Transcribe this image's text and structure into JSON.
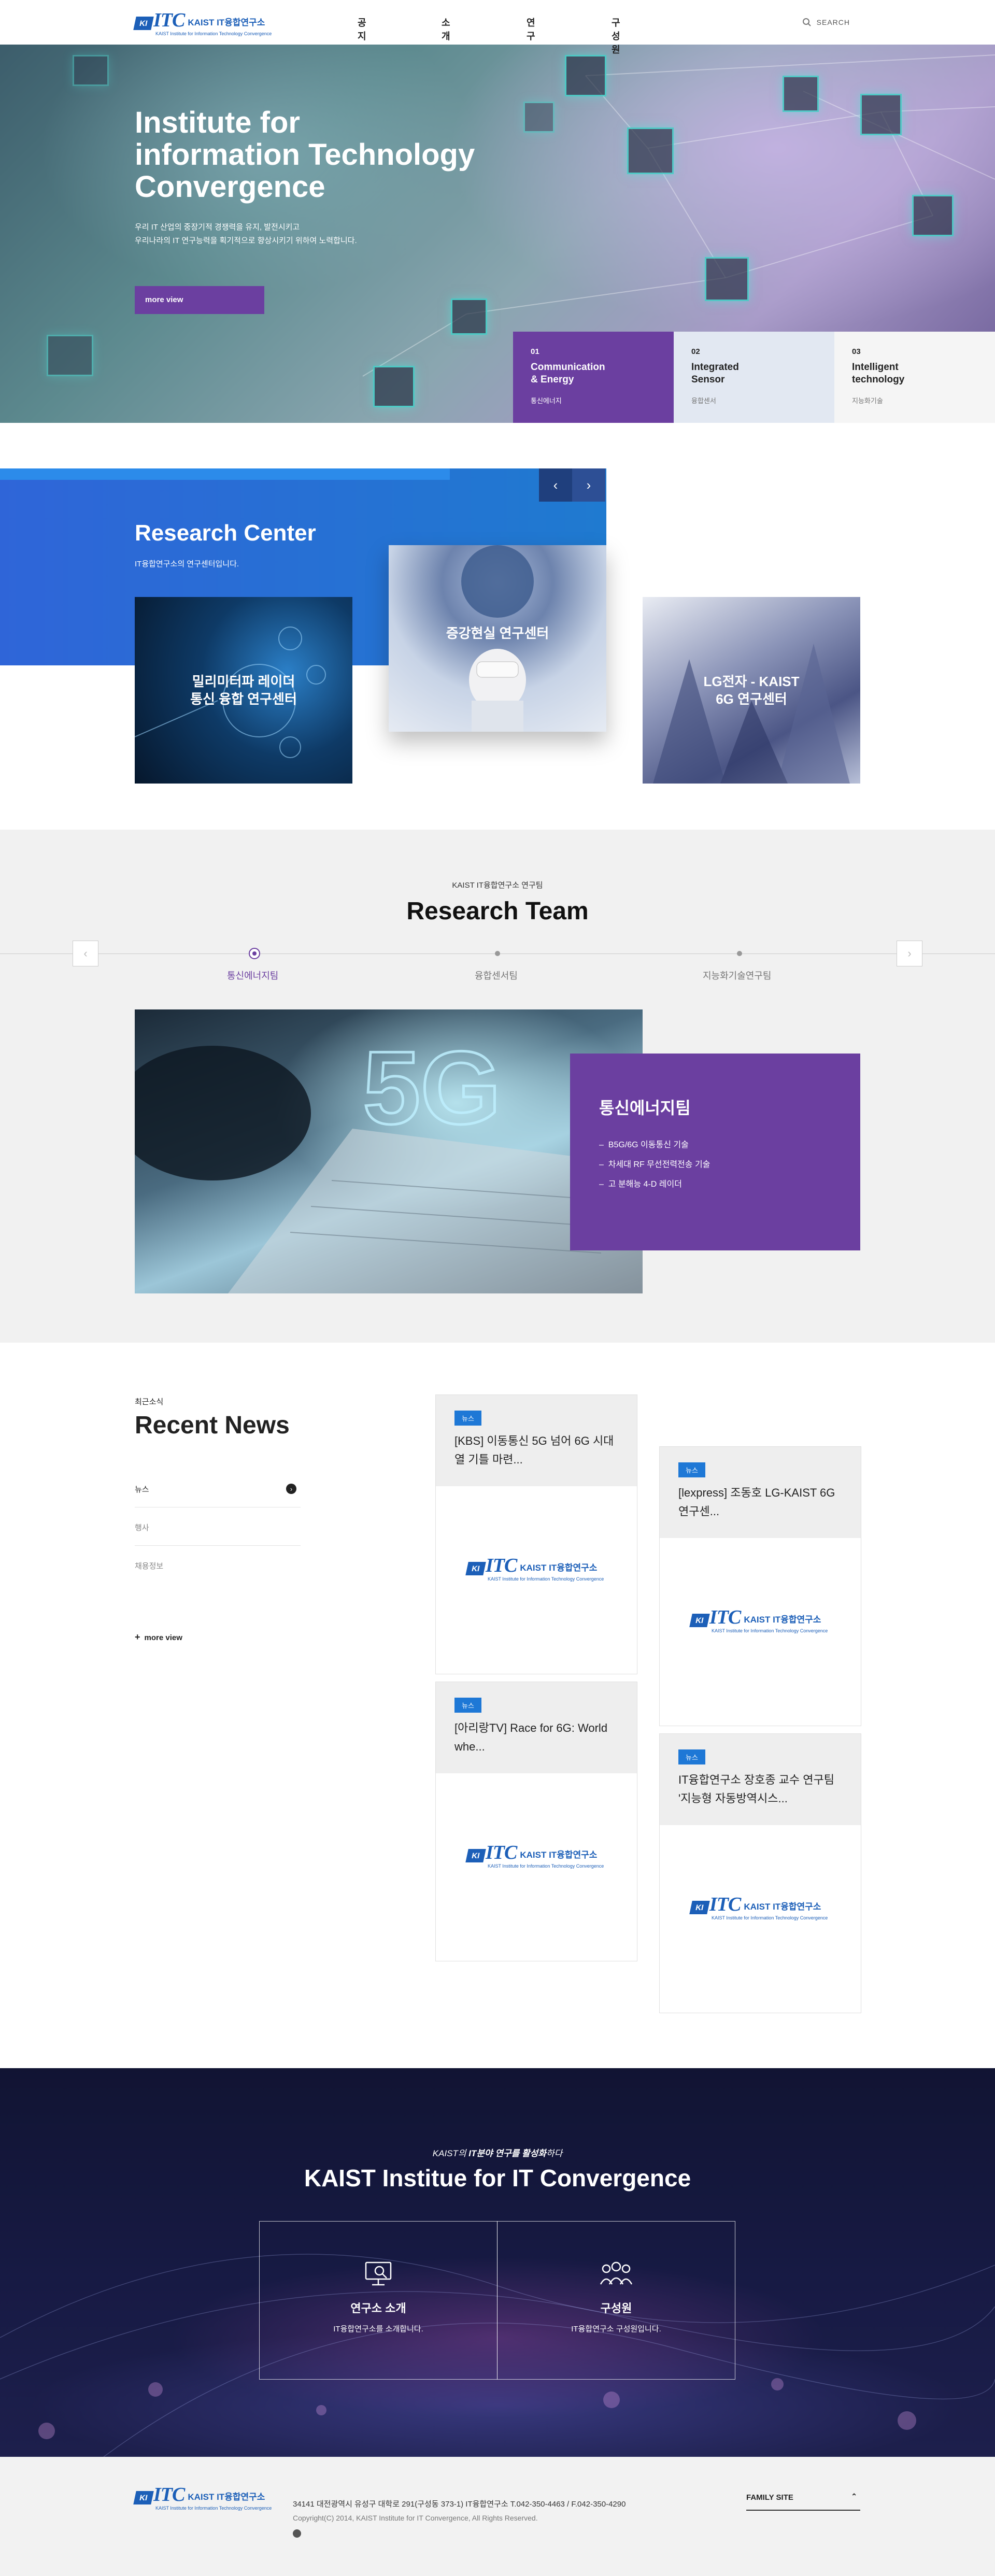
{
  "header": {
    "logo": {
      "badge": "KI",
      "name": "ITC",
      "ko": "KAIST IT융합연구소",
      "sub": "KAIST Institute for Information Technology Convergence"
    },
    "nav": [
      "공지",
      "소개",
      "연구",
      "구성원"
    ],
    "search_label": "SEARCH"
  },
  "hero": {
    "title_lines": [
      "Institute for",
      "information Technology",
      "Convergence"
    ],
    "desc_lines": [
      "우리 IT 산업의 중장기적 경쟁력을 유지, 발전시키고",
      "우리나라의 IT 연구능력을 획기적으로 향상시키기 위하여 노력합니다."
    ],
    "more_label": "more view",
    "tabs": [
      {
        "num": "01",
        "name_lines": [
          "Communication",
          "& Energy"
        ],
        "ko": "통신에너지"
      },
      {
        "num": "02",
        "name_lines": [
          "Integrated",
          "Sensor"
        ],
        "ko": "융합센서"
      },
      {
        "num": "03",
        "name_lines": [
          "Intelligent",
          "technology"
        ],
        "ko": "지능화기술"
      }
    ]
  },
  "research_center": {
    "title": "Research Center",
    "subtitle": "IT융합연구소의 연구센터입니다.",
    "prev_arrow": "‹",
    "next_arrow": "›",
    "cards": [
      {
        "lines": [
          "밀리미터파 레이더",
          "통신 융합 연구센터"
        ]
      },
      {
        "lines": [
          "증강현실 연구센터"
        ]
      },
      {
        "lines": [
          "LG전자 - KAIST",
          "6G 연구센터"
        ]
      }
    ]
  },
  "research_team": {
    "kicker": "KAIST IT융합연구소 연구팀",
    "title": "Research Team",
    "tabs": [
      "통신에너지팀",
      "융합센서팀",
      "지능화기술연구팀"
    ],
    "prev_arrow": "‹",
    "next_arrow": "›",
    "active": {
      "title": "통신에너지팀",
      "items": [
        "B5G/6G 이동통신 기술",
        "차세대 RF 무선전력전송 기술",
        "고 분해능 4-D 레이더"
      ]
    }
  },
  "news": {
    "kicker": "최근소식",
    "title": "Recent News",
    "categories": [
      "뉴스",
      "행사",
      "채용정보"
    ],
    "more_label": "more view",
    "cards": [
      {
        "tag": "뉴스",
        "title_lines": [
          "[KBS] 이동통신 5G 넘어 6G 시대",
          "열 기틀 마련..."
        ]
      },
      {
        "tag": "뉴스",
        "title_lines": [
          "[lexpress] 조동호 LG-KAIST 6G",
          "연구센..."
        ]
      },
      {
        "tag": "뉴스",
        "title_lines": [
          "[아리랑TV] Race for 6G: World",
          "whe..."
        ]
      },
      {
        "tag": "뉴스",
        "title_lines": [
          "IT융합연구소 장호종 교수 연구팀",
          "'지능형 자동방역시스..."
        ]
      }
    ]
  },
  "banner": {
    "kicker_pre": "KAIST의 ",
    "kicker_bold": "IT분야 연구를 활성화",
    "kicker_post": "하다",
    "title": "KAIST Institue for IT Convergence",
    "boxes": [
      {
        "icon": "monitor-icon",
        "title": "연구소 소개",
        "sub": "IT융합연구소를 소개합니다."
      },
      {
        "icon": "people-icon",
        "title": "구성원",
        "sub": "IT융합연구소 구성원입니다."
      }
    ]
  },
  "footer": {
    "address": "34141 대전광역시 유성구 대학로 291(구성동 373-1) IT융합연구소 T.042-350-4463 / F.042-350-4290",
    "copyright": "Copyright(C) 2014, KAIST Institute for IT Convergence, All Rights Reserved.",
    "family_site": "FAMILY SITE"
  },
  "colors": {
    "brand_blue": "#1c5fb8",
    "accent_purple": "#6b3fa0",
    "navy": "#151839",
    "news_tag": "#1e78d6"
  }
}
